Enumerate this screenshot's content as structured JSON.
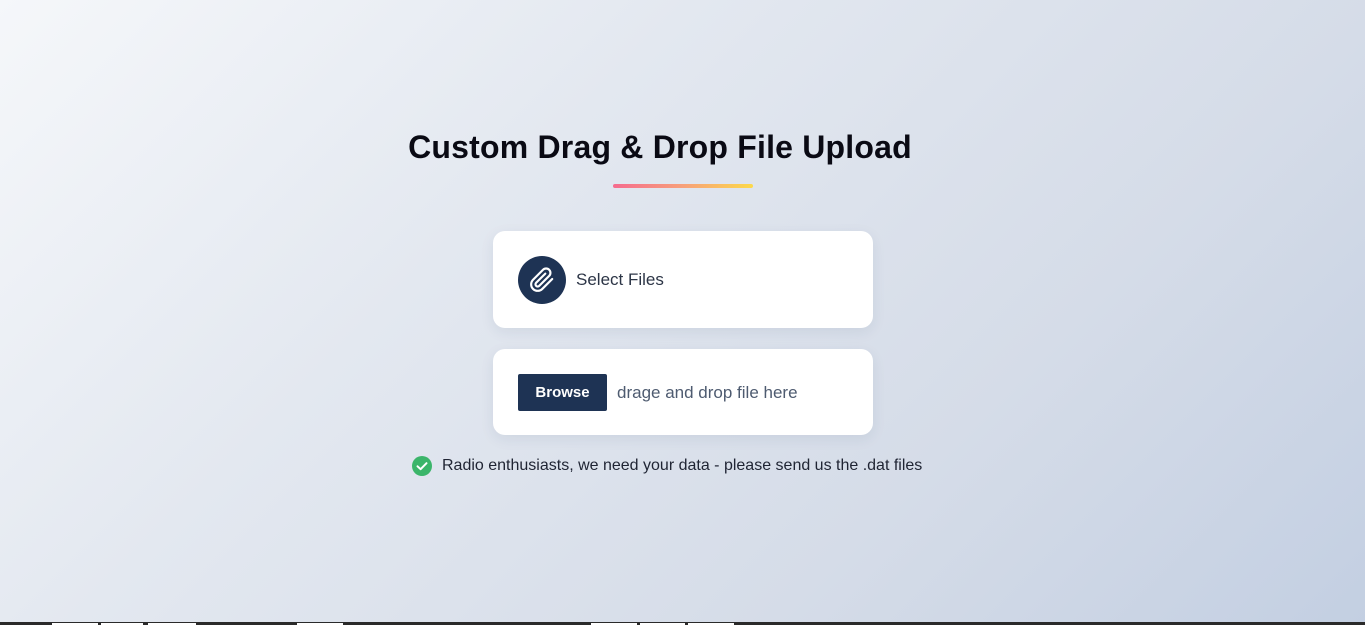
{
  "page": {
    "title": "Custom Drag & Drop File Upload"
  },
  "select_card": {
    "icon": "paperclip-icon",
    "label": "Select Files"
  },
  "drop_card": {
    "browse_label": "Browse",
    "hint": "drage and drop file here"
  },
  "notice": {
    "icon": "check-circle-icon",
    "text": "Radio enthusiasts, we need your data - please send us the .dat files"
  },
  "colors": {
    "primary": "#1e3354",
    "success": "#3bb56a",
    "underline_start": "#f56b8e",
    "underline_end": "#fcd94a"
  }
}
